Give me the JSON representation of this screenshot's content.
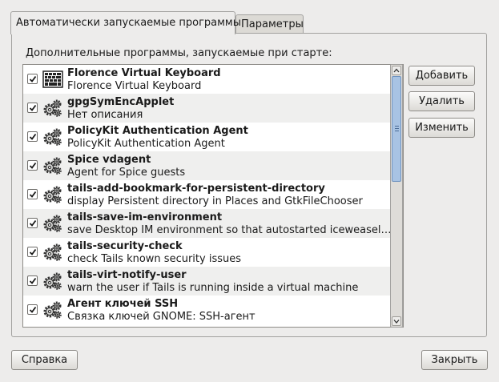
{
  "tabs": [
    {
      "label": "Автоматически запускаемые программы",
      "active": true
    },
    {
      "label": "Параметры",
      "active": false
    }
  ],
  "section_label": "Дополнительные программы, запускаемые при старте:",
  "startup_programs": [
    {
      "checked": true,
      "icon": "keyboard-icon",
      "name": "Florence Virtual Keyboard",
      "description": "Florence Virtual Keyboard"
    },
    {
      "checked": true,
      "icon": "gears-icon",
      "name": "gpgSymEncApplet",
      "description": "Нет описания"
    },
    {
      "checked": true,
      "icon": "gears-icon",
      "name": "PolicyKit Authentication Agent",
      "description": "PolicyKit Authentication Agent"
    },
    {
      "checked": true,
      "icon": "gears-icon",
      "name": "Spice vdagent",
      "description": "Agent for Spice guests"
    },
    {
      "checked": true,
      "icon": "gears-icon",
      "name": "tails-add-bookmark-for-persistent-directory",
      "description": "display Persistent directory in Places and GtkFileChooser"
    },
    {
      "checked": true,
      "icon": "gears-icon",
      "name": "tails-save-im-environment",
      "description": "save Desktop IM environment so that autostarted iceweasel …"
    },
    {
      "checked": true,
      "icon": "gears-icon",
      "name": "tails-security-check",
      "description": "check Tails known security issues"
    },
    {
      "checked": true,
      "icon": "gears-icon",
      "name": "tails-virt-notify-user",
      "description": "warn the user if Tails is running inside a virtual machine"
    },
    {
      "checked": true,
      "icon": "gears-icon",
      "name": "Агент ключей SSH",
      "description": "Связка ключей GNOME: SSH-агент"
    }
  ],
  "side_buttons": {
    "add": "Добавить",
    "remove": "Удалить",
    "edit": "Изменить"
  },
  "bottom_buttons": {
    "help": "Справка",
    "close": "Закрыть"
  },
  "colors": {
    "window_bg": "#edeceb",
    "scroll_thumb": "#a8c3e3",
    "row_alt": "#efefee"
  }
}
